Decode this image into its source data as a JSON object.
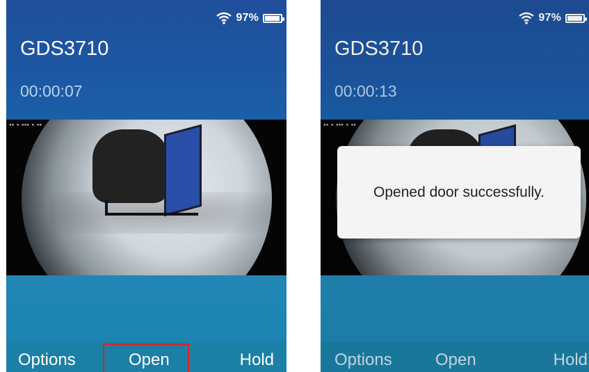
{
  "status": {
    "battery_percent": "97%",
    "battery_level": 0.97
  },
  "call": {
    "device_name": "GDS3710"
  },
  "left_screen": {
    "timer": "00:00:07",
    "video_overlay_text": "▪▪ ▪ ▪▪▪ ▪ ▪▪"
  },
  "right_screen": {
    "timer": "00:00:13",
    "video_overlay_text": "▪▪ ▪ ▪▪▪ ▪ ▪▪",
    "toast_message": "Opened door successfully."
  },
  "softkeys": {
    "options": "Options",
    "open": "Open",
    "hold": "Hold"
  },
  "icons": {
    "wifi": "wifi-icon",
    "battery": "battery-icon"
  },
  "colors": {
    "header_blue": "#1f4f9a",
    "teal_panel": "#2285b6",
    "highlight_red": "#e02020"
  }
}
